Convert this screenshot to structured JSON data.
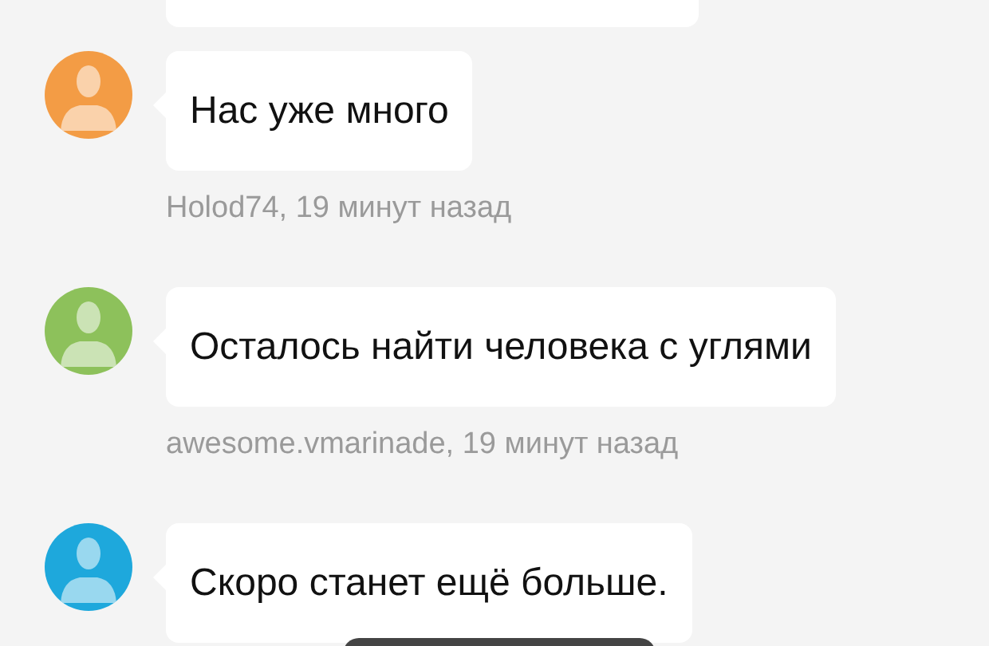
{
  "messages": [
    {
      "text": "Нас уже много",
      "meta": "Holod74, 19 минут назад",
      "color": "#f39c45"
    },
    {
      "text": "Осталось найти человека с углями",
      "meta": "awesome.vmarinade, 19 минут назад",
      "color": "#8dc15b"
    },
    {
      "text": "Скоро станет ещё больше.",
      "color": "#1ea8dc"
    }
  ]
}
